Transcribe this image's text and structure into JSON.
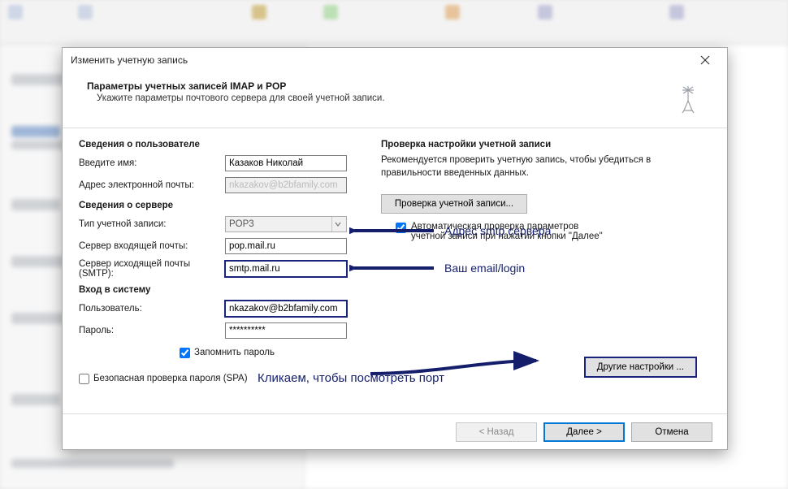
{
  "window": {
    "title": "Изменить учетную запись"
  },
  "header": {
    "title": "Параметры учетных записей IMAP и POP",
    "subtitle": "Укажите параметры почтового сервера для своей учетной записи."
  },
  "labels": {
    "user_info": "Сведения о пользователе",
    "enter_name": "Введите имя:",
    "email_addr": "Адрес электронной почты:",
    "server_info": "Сведения о сервере",
    "account_type": "Тип учетной записи:",
    "incoming": "Сервер входящей почты:",
    "outgoing": "Сервер исходящей почты (SMTP):",
    "logon_info": "Вход в систему",
    "username": "Пользователь:",
    "password": "Пароль:",
    "remember_pw": "Запомнить пароль",
    "spa": "Безопасная проверка пароля (SPA)",
    "test_title": "Проверка настройки учетной записи",
    "test_desc": "Рекомендуется проверить учетную запись, чтобы убедиться в правильности введенных данных.",
    "test_btn": "Проверка учетной записи...",
    "auto_test": "Автоматическая проверка параметров учетной записи при нажатии кнопки \"Далее\"",
    "more_settings": "Другие настройки ..."
  },
  "values": {
    "name": "Казаков Николай",
    "email_masked": "nkazakov@b2bfamily.com",
    "account_type": "POP3",
    "incoming": "pop.mail.ru",
    "outgoing": "smtp.mail.ru",
    "username": "nkazakov@b2bfamily.com",
    "password": "**********"
  },
  "buttons": {
    "back": "< Назад",
    "next": "Далее >",
    "cancel": "Отмена"
  },
  "annotations": {
    "smtp": "Адрес smtp сервера",
    "login": "Ваш email/login",
    "click": "Кликаем, чтобы посмотреть порт"
  }
}
